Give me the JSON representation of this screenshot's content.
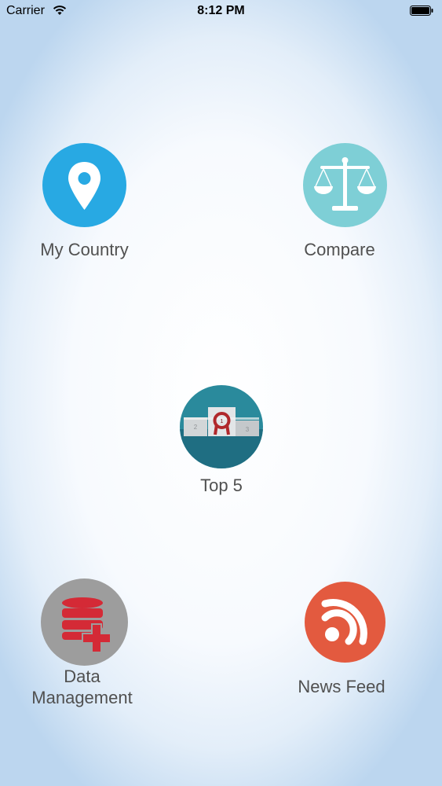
{
  "status_bar": {
    "carrier": "Carrier",
    "time": "8:12 PM"
  },
  "menu": {
    "my_country": {
      "label": "My Country",
      "icon": "location-pin-icon",
      "color": "#28a9e3"
    },
    "compare": {
      "label": "Compare",
      "icon": "balance-scale-icon",
      "color": "#7ecfd6"
    },
    "top5": {
      "label": "Top 5",
      "icon": "podium-icon",
      "color": "#2a8a9c"
    },
    "data_management": {
      "label_line1": "Data",
      "label_line2": "Management",
      "icon": "database-add-icon",
      "color": "#9d9d9d"
    },
    "news_feed": {
      "label": "News Feed",
      "icon": "rss-feed-icon",
      "color": "#e35a3f"
    }
  }
}
